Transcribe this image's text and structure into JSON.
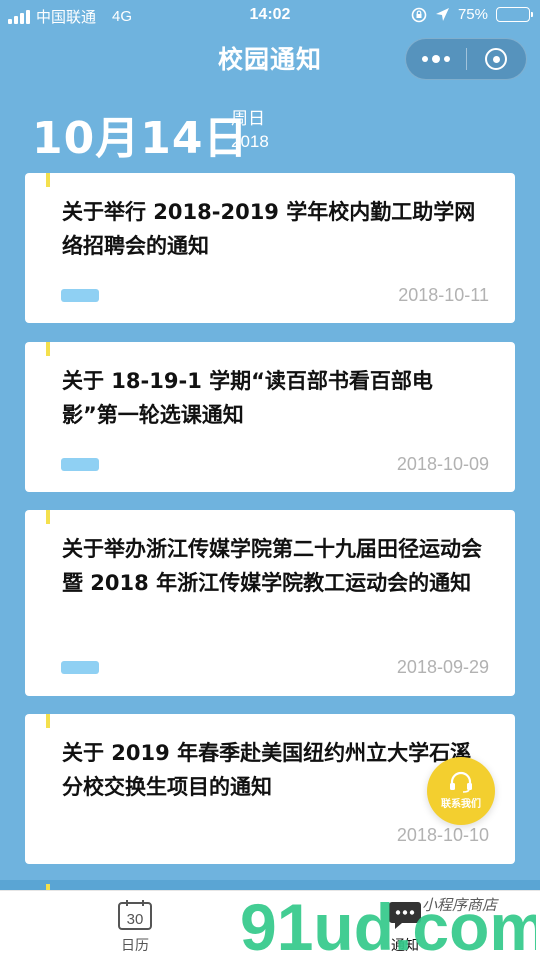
{
  "status_bar": {
    "carrier": "中国联通",
    "network": "4G",
    "time": "14:02",
    "battery": "75%",
    "battery_level": 0.75
  },
  "nav": {
    "title": "校园通知"
  },
  "date_header": {
    "day": "10月14日",
    "weekday": "周日",
    "year": "2018"
  },
  "notices": [
    {
      "title": "关于举行 2018-2019 学年校内勤工助学网络招聘会的通知",
      "date": "2018-10-11"
    },
    {
      "title": "关于 18-19-1 学期“读百部书看百部电影”第一轮选课通知",
      "date": "2018-10-09"
    },
    {
      "title": "关于举办浙江传媒学院第二十九届田径运动会暨 2018 年浙江传媒学院教工运动会的通知",
      "date": "2018-09-29"
    },
    {
      "title": "关于 2019 年春季赴美国纽约州立大学石溪分校交换生项目的通知",
      "date": "2018-10-10"
    }
  ],
  "contact_button": {
    "label": "联系我们"
  },
  "tabbar": {
    "calendar_label": "日历",
    "calendar_day": "30",
    "notice_label": "通知"
  },
  "watermark": {
    "brand": "91ud.com",
    "tagline": "小程序商店"
  },
  "colors": {
    "background": "#6fb3de",
    "accent_yellow": "#f4e04d",
    "tag_blue": "#8fd0f3",
    "fab_yellow": "#f3cf2f"
  }
}
